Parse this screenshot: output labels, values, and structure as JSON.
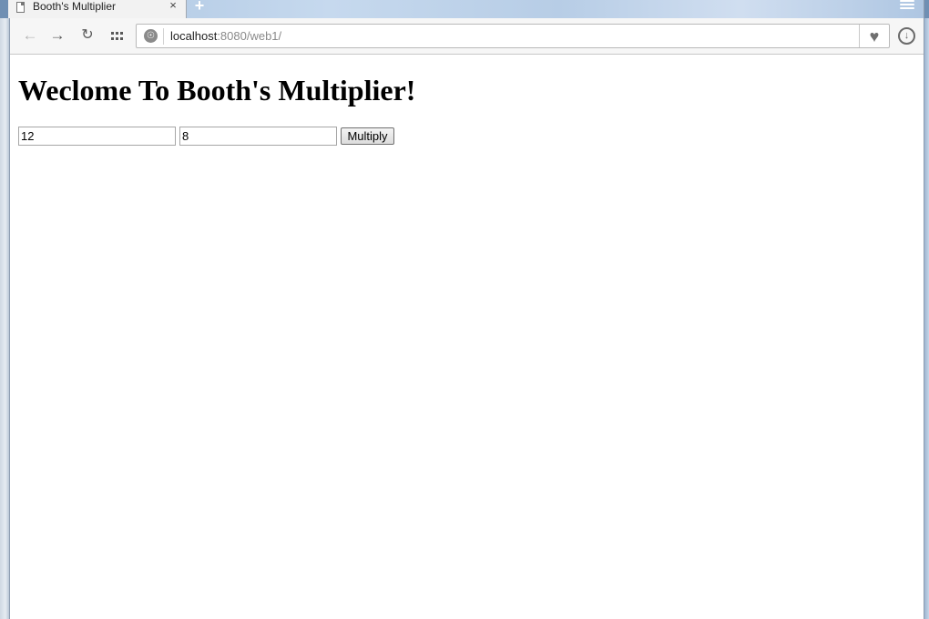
{
  "browser": {
    "tab_title": "Booth's Multiplier",
    "tab_close": "×",
    "new_tab": "+",
    "url_host": "localhost",
    "url_path": ":8080/web1/"
  },
  "icons": {
    "back": "back-arrow-icon",
    "forward": "forward-arrow-icon",
    "reload": "reload-icon",
    "apps": "apps-grid-icon",
    "site": "globe-icon",
    "bookmark": "heart-icon",
    "download": "download-icon",
    "menu": "menu-icon"
  },
  "page": {
    "heading": "Weclome To Booth's Multiplier!",
    "input_a_value": "12",
    "input_b_value": "8",
    "button_label": "Multiply"
  }
}
